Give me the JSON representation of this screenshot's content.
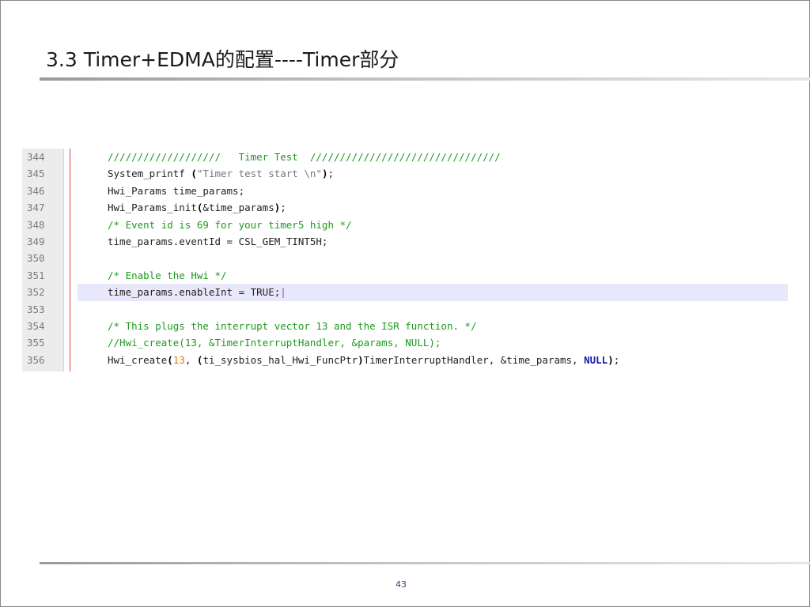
{
  "slide": {
    "title": "3.3 Timer+EDMA的配置----Timer部分",
    "page_number": "43"
  },
  "code": {
    "lines": [
      {
        "num": "344",
        "tokens": [
          {
            "t": "///////////////////   Timer Test  ////////////////////////////////",
            "c": "comment"
          }
        ]
      },
      {
        "num": "345",
        "tokens": [
          {
            "t": "System_printf ",
            "c": "plain"
          },
          {
            "t": "(",
            "c": "paren"
          },
          {
            "t": "\"Timer test start \\n\"",
            "c": "string"
          },
          {
            "t": ")",
            "c": "paren"
          },
          {
            "t": ";",
            "c": "plain"
          }
        ]
      },
      {
        "num": "346",
        "tokens": [
          {
            "t": "Hwi_Params time_params;",
            "c": "plain"
          }
        ]
      },
      {
        "num": "347",
        "tokens": [
          {
            "t": "Hwi_Params_init",
            "c": "plain"
          },
          {
            "t": "(",
            "c": "paren"
          },
          {
            "t": "&time_params",
            "c": "plain"
          },
          {
            "t": ")",
            "c": "paren"
          },
          {
            "t": ";",
            "c": "plain"
          }
        ]
      },
      {
        "num": "348",
        "tokens": [
          {
            "t": "/* Event id is 69 for your timer5 high */",
            "c": "comment"
          }
        ]
      },
      {
        "num": "349",
        "tokens": [
          {
            "t": "time_params.eventId = CSL_GEM_TINT5H;",
            "c": "plain"
          }
        ]
      },
      {
        "num": "350",
        "tokens": []
      },
      {
        "num": "351",
        "tokens": [
          {
            "t": "/* Enable the Hwi */",
            "c": "comment"
          }
        ]
      },
      {
        "num": "352",
        "current": true,
        "tokens": [
          {
            "t": "time_params.enableInt = TRUE;",
            "c": "plain"
          },
          {
            "t": "|",
            "c": "caret"
          }
        ]
      },
      {
        "num": "353",
        "tokens": []
      },
      {
        "num": "354",
        "tokens": [
          {
            "t": "/* This plugs the interrupt vector 13 and the ISR function. */",
            "c": "comment"
          }
        ]
      },
      {
        "num": "355",
        "tokens": [
          {
            "t": "//Hwi_create(13, &TimerInterruptHandler, &params, NULL);",
            "c": "comment"
          }
        ]
      },
      {
        "num": "356",
        "tokens": [
          {
            "t": "Hwi_create",
            "c": "plain"
          },
          {
            "t": "(",
            "c": "paren"
          },
          {
            "t": "13",
            "c": "number"
          },
          {
            "t": ", ",
            "c": "plain"
          },
          {
            "t": "(",
            "c": "paren"
          },
          {
            "t": "ti_sysbios_hal_Hwi_FuncPtr",
            "c": "plain"
          },
          {
            "t": ")",
            "c": "paren"
          },
          {
            "t": "TimerInterruptHandler, &time_params, ",
            "c": "plain"
          },
          {
            "t": "NULL",
            "c": "keyword"
          },
          {
            "t": ")",
            "c": "paren"
          },
          {
            "t": ";",
            "c": "plain"
          }
        ]
      }
    ]
  }
}
